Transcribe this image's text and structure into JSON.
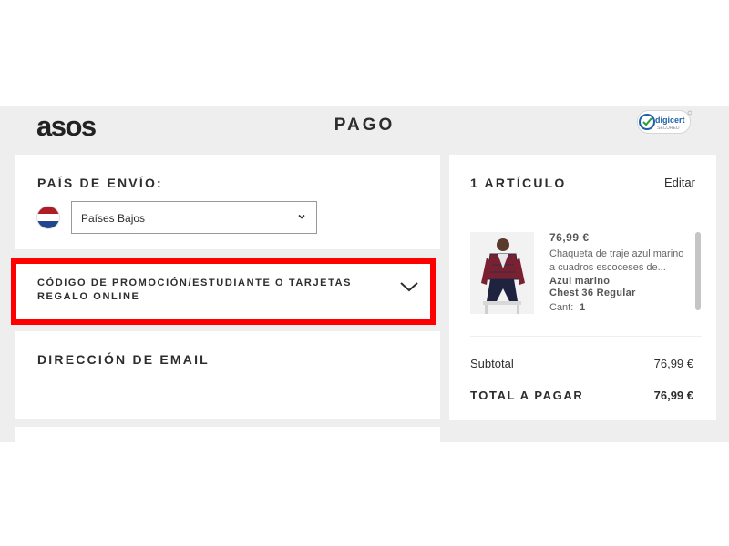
{
  "header": {
    "logo_text": "asos",
    "title": "PAGO",
    "badge_text": "digicert",
    "badge_subtext": "SECURED"
  },
  "shipping": {
    "heading": "PAÍS DE ENVÍO:",
    "country_value": "Países Bajos",
    "flag_colors": [
      "#ae1c28",
      "#ffffff",
      "#21468b"
    ]
  },
  "promo": {
    "label": "CÓDIGO DE PROMOCIÓN/ESTUDIANTE O TARJETAS REGALO ONLINE",
    "highlight_color": "#ff0000"
  },
  "email": {
    "heading": "DIRECCIÓN DE EMAIL"
  },
  "summary": {
    "heading": "1 ARTÍCULO",
    "edit_label": "Editar",
    "item": {
      "price": "76,99 €",
      "description": "Chaqueta de traje azul marino a cuadros escoceses de...",
      "color": "Azul marino",
      "size": "Chest 36 Regular",
      "qty_label": "Cant:",
      "qty_value": "1"
    },
    "subtotal_label": "Subtotal",
    "subtotal_value": "76,99 €",
    "total_label": "TOTAL A PAGAR",
    "total_value": "76,99 €"
  }
}
